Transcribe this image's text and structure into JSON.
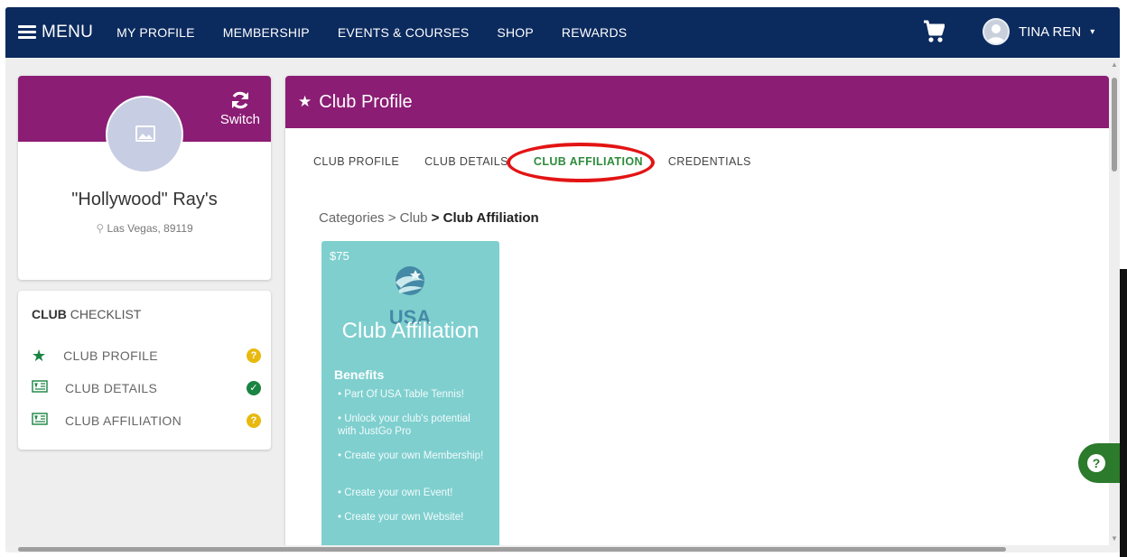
{
  "nav": {
    "menu_label": "MENU",
    "links": [
      "MY PROFILE",
      "MEMBERSHIP",
      "EVENTS & COURSES",
      "SHOP",
      "REWARDS"
    ],
    "user_name": "TINA REN",
    "caret": "▾"
  },
  "profile": {
    "switch_label": "Switch",
    "club_name": "\"Hollywood\" Ray's",
    "location": "Las Vegas, 89119"
  },
  "checklist": {
    "title_bold": "CLUB",
    "title_rest": " CHECKLIST",
    "items": [
      {
        "label": "CLUB PROFILE",
        "icon": "star-icon",
        "status": "?"
      },
      {
        "label": "CLUB DETAILS",
        "icon": "id-card-icon",
        "status": "✓"
      },
      {
        "label": "CLUB AFFILIATION",
        "icon": "id-card-icon",
        "status": "?"
      }
    ]
  },
  "main": {
    "title": "Club Profile",
    "tabs": [
      "CLUB PROFILE",
      "CLUB DETAILS",
      "CLUB AFFILIATION",
      "CREDENTIALS"
    ],
    "active_tab": "CLUB AFFILIATION",
    "breadcrumb": {
      "part1": "Categories",
      "sep1": " > ",
      "part2": "Club",
      "sep2": " > ",
      "current": "Club Affiliation"
    },
    "tile": {
      "price": "$75",
      "logo_text": "USA",
      "title": "Club Affiliation",
      "benefits_label": "Benefits",
      "benefits": [
        "Part Of USA Table Tennis!",
        "Unlock your club's potential with JustGo Pro",
        "Create your own Membership!",
        "Create your own Event!",
        "Create your own Website!"
      ]
    }
  },
  "help_label": "?",
  "colors": {
    "nav_bg": "#0b2a5e",
    "brand_purple": "#8b1d74",
    "tile_teal": "#7fcfcf",
    "active_tab_green": "#2e8b3b",
    "highlight_red": "#e31414"
  }
}
